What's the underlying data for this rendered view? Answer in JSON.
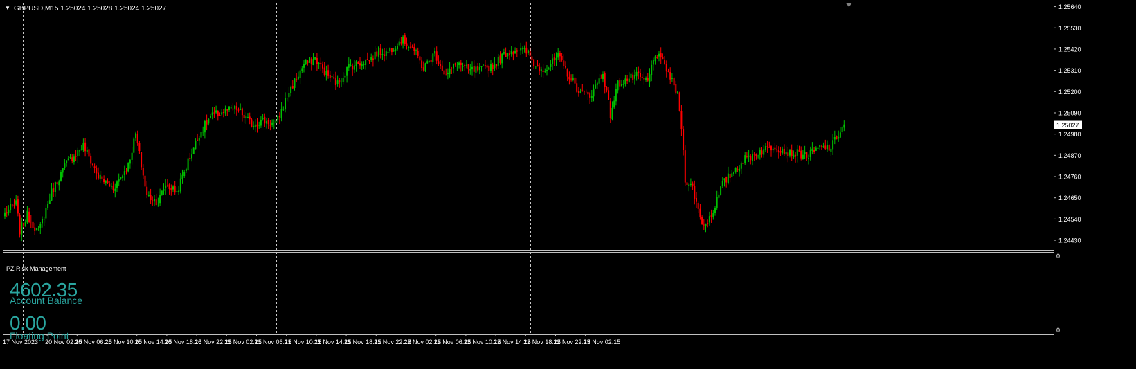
{
  "window": {
    "symbol_line": "GBPUSD,M15  1.25024 1.25028 1.25024 1.25027",
    "menu_arrow_icon": "triangle-down-icon"
  },
  "colors": {
    "background": "#000000",
    "bull": "#00c000",
    "bear": "#ff0000",
    "grid": "#c8c8c8",
    "frame": "#c0c0c0",
    "indicator_text": "#2aa6a0"
  },
  "indicator": {
    "title": "PZ Risk Management",
    "balance_value": "4602.35",
    "balance_label": "Account Balance",
    "floating_value": "0.00",
    "floating_label": "Floating Point",
    "scale_labels": [
      "0",
      "0"
    ]
  },
  "chart_data": {
    "type": "candlestick",
    "symbol": "GBPUSD",
    "timeframe": "M15",
    "ylim": [
      1.2438,
      1.2566
    ],
    "y_ticks": [
      "1.25640",
      "1.25530",
      "1.25420",
      "1.25310",
      "1.25200",
      "1.25090",
      "1.24980",
      "1.24870",
      "1.24760",
      "1.24650",
      "1.24540",
      "1.24430"
    ],
    "current_price": "1.25027",
    "x_ticks": [
      "17 Nov 2023",
      "20 Nov 02:15",
      "20 Nov 06:15",
      "20 Nov 10:15",
      "20 Nov 14:15",
      "20 Nov 18:15",
      "20 Nov 22:15",
      "21 Nov 02:15",
      "21 Nov 06:15",
      "21 Nov 10:15",
      "21 Nov 14:15",
      "21 Nov 18:15",
      "21 Nov 22:15",
      "22 Nov 02:15",
      "22 Nov 06:15",
      "22 Nov 10:15",
      "22 Nov 14:15",
      "22 Nov 18:15",
      "22 Nov 22:15",
      "23 Nov 02:15"
    ],
    "bars_per_tick": 16,
    "first_tick_bar": 7,
    "close_path": [
      [
        0,
        1.2457
      ],
      [
        6,
        1.2462
      ],
      [
        8,
        1.2448
      ],
      [
        12,
        1.2456
      ],
      [
        18,
        1.2447
      ],
      [
        25,
        1.2468
      ],
      [
        33,
        1.2483
      ],
      [
        42,
        1.2492
      ],
      [
        50,
        1.2476
      ],
      [
        58,
        1.247
      ],
      [
        66,
        1.2482
      ],
      [
        70,
        1.2498
      ],
      [
        76,
        1.2466
      ],
      [
        82,
        1.2463
      ],
      [
        86,
        1.2472
      ],
      [
        92,
        1.2468
      ],
      [
        98,
        1.2484
      ],
      [
        104,
        1.2498
      ],
      [
        110,
        1.2507
      ],
      [
        118,
        1.251
      ],
      [
        124,
        1.2511
      ],
      [
        132,
        1.2503
      ],
      [
        138,
        1.2505
      ],
      [
        145,
        1.2503
      ],
      [
        152,
        1.252
      ],
      [
        160,
        1.2534
      ],
      [
        166,
        1.2537
      ],
      [
        172,
        1.2529
      ],
      [
        178,
        1.2524
      ],
      [
        184,
        1.2533
      ],
      [
        190,
        1.2535
      ],
      [
        196,
        1.2537
      ],
      [
        200,
        1.2541
      ],
      [
        204,
        1.254
      ],
      [
        212,
        1.2547
      ],
      [
        218,
        1.2543
      ],
      [
        224,
        1.2532
      ],
      [
        230,
        1.254
      ],
      [
        236,
        1.2528
      ],
      [
        242,
        1.2535
      ],
      [
        248,
        1.2531
      ],
      [
        255,
        1.2531
      ],
      [
        262,
        1.2534
      ],
      [
        268,
        1.254
      ],
      [
        274,
        1.2542
      ],
      [
        280,
        1.254
      ],
      [
        284,
        1.2533
      ],
      [
        290,
        1.2532
      ],
      [
        296,
        1.2538
      ],
      [
        302,
        1.2528
      ],
      [
        308,
        1.2519
      ],
      [
        314,
        1.2519
      ],
      [
        320,
        1.253
      ],
      [
        324,
        1.2508
      ],
      [
        328,
        1.2524
      ],
      [
        332,
        1.2526
      ],
      [
        338,
        1.2528
      ],
      [
        344,
        1.2525
      ],
      [
        348,
        1.254
      ],
      [
        354,
        1.2532
      ],
      [
        360,
        1.2518
      ],
      [
        362,
        1.2502
      ],
      [
        364,
        1.2475
      ],
      [
        368,
        1.247
      ],
      [
        372,
        1.2455
      ],
      [
        374,
        1.2451
      ],
      [
        378,
        1.2456
      ],
      [
        384,
        1.2472
      ],
      [
        390,
        1.2479
      ],
      [
        396,
        1.2485
      ],
      [
        404,
        1.2489
      ],
      [
        412,
        1.2492
      ],
      [
        420,
        1.2488
      ],
      [
        424,
        1.2488
      ],
      [
        430,
        1.2487
      ],
      [
        436,
        1.2491
      ],
      [
        442,
        1.2491
      ],
      [
        446,
        1.2498
      ],
      [
        449,
        1.2503
      ]
    ]
  }
}
